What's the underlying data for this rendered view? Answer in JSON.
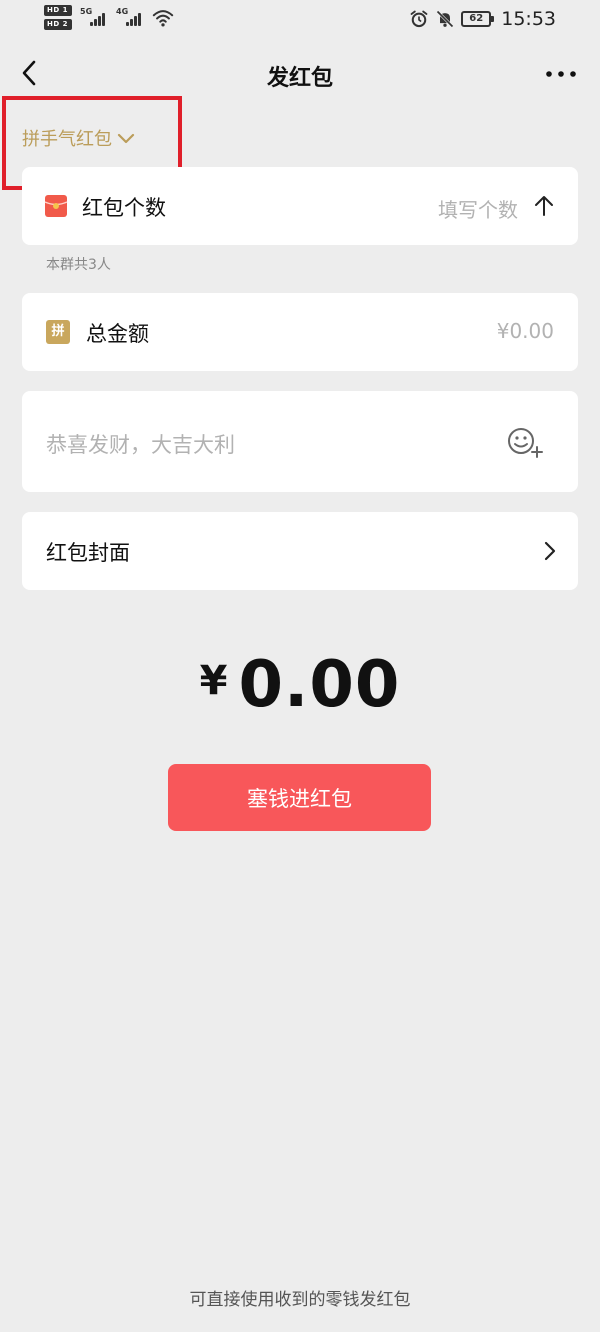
{
  "status_bar": {
    "hd1": "HD 1",
    "hd2": "HD 2",
    "net1": "5G",
    "net2": "4G",
    "battery": "62",
    "time": "15:53"
  },
  "header": {
    "title": "发红包",
    "back_icon": "chevron-left-icon",
    "more_icon": "more-icon"
  },
  "type_switch": {
    "label": "拼手气红包",
    "icon": "chevron-down-icon"
  },
  "count_row": {
    "label": "红包个数",
    "placeholder": "填写个数",
    "icon": "red-packet-icon",
    "hint": "本群共3人"
  },
  "amount_row": {
    "badge": "拼",
    "label": "总金额",
    "placeholder": "¥0.00"
  },
  "message_row": {
    "placeholder": "恭喜发财，大吉大利",
    "icon": "emoji-add-icon"
  },
  "cover_row": {
    "label": "红包封面",
    "icon": "chevron-right-icon"
  },
  "total": {
    "symbol": "¥",
    "value": "0.00"
  },
  "submit": {
    "label": "塞钱进红包"
  },
  "footer": {
    "text": "可直接使用收到的零钱发红包"
  },
  "colors": {
    "background": "#ededed",
    "accent_gold": "#bb9d5a",
    "primary_red": "#f8575a",
    "highlight_red": "#e01f2a"
  }
}
